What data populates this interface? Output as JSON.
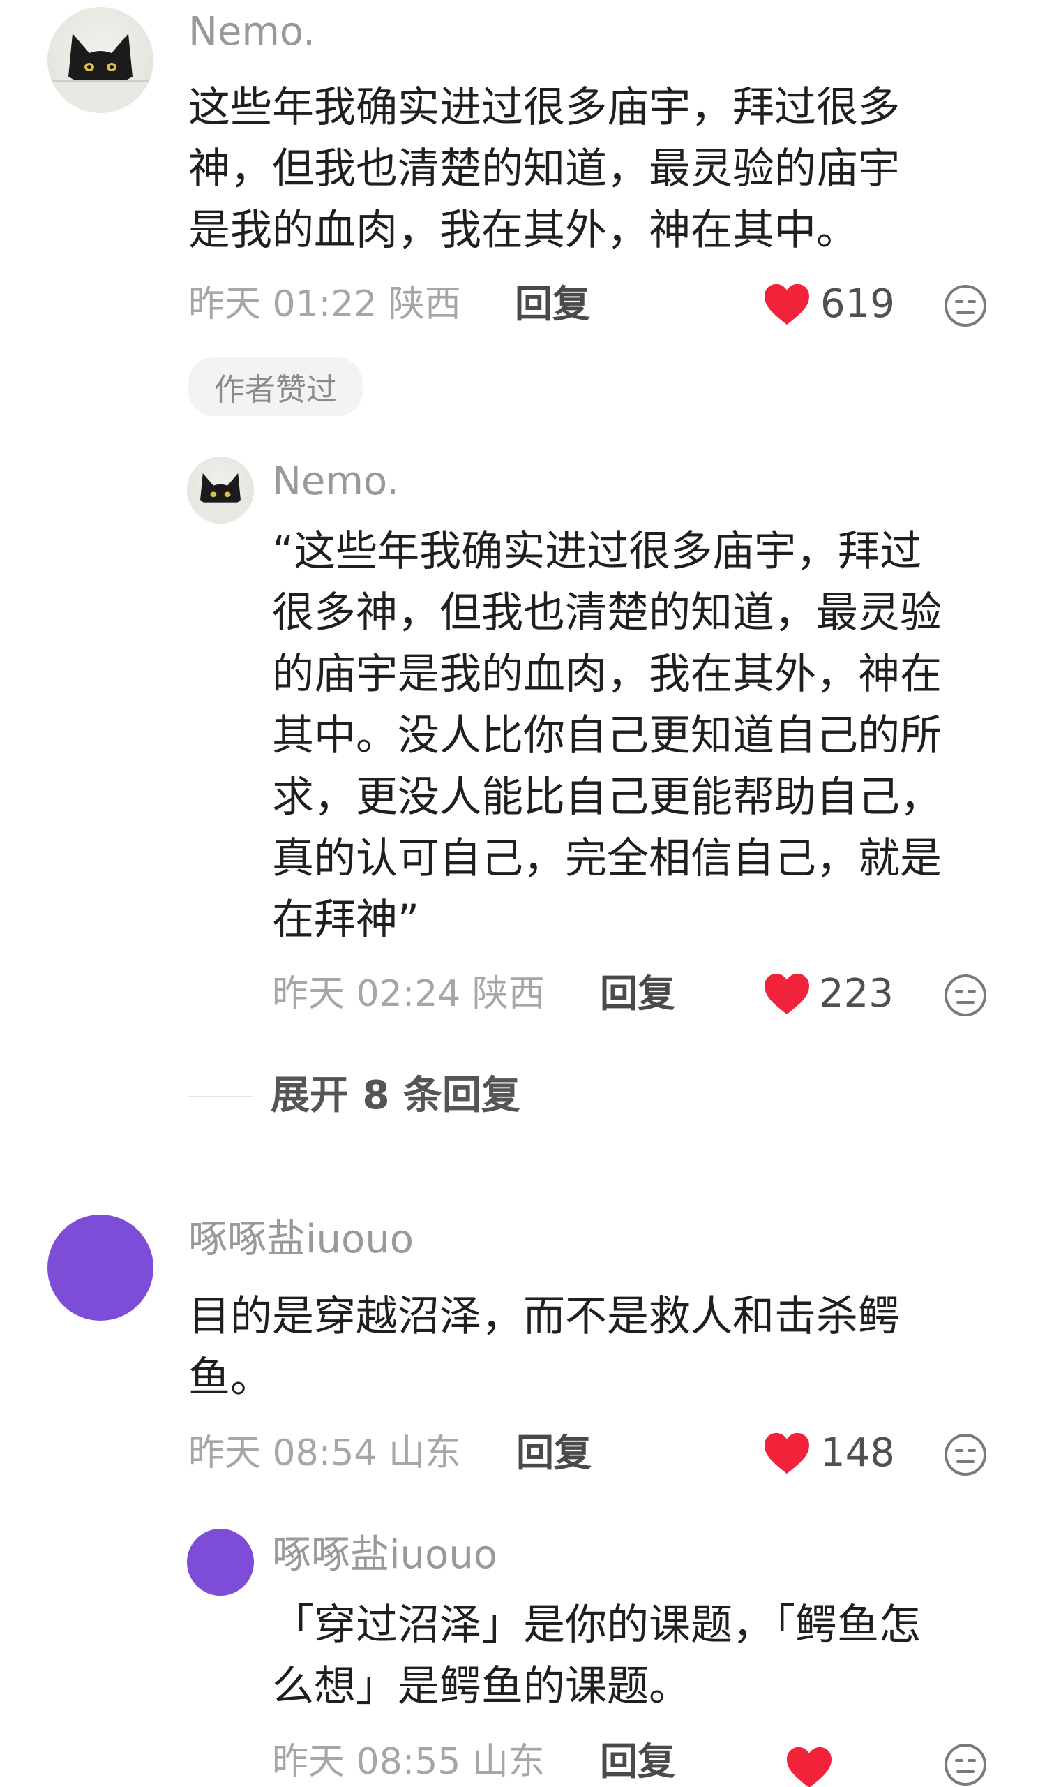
{
  "comments": [
    {
      "username": "Nemo.",
      "text": "这些年我确实进过很多庙宇，拜过很多\n神，但我也清楚的知道，最灵验的庙宇\n是我的血肉，我在其外，神在其中。",
      "time": "昨天 01:22",
      "location": "陕西",
      "reply_label": "回复",
      "likes": "619",
      "badge": "作者赞过"
    },
    {
      "username": "Nemo.",
      "text": "“这些年我确实进过很多庙宇，拜过\n很多神，但我也清楚的知道，最灵验\n的庙宇是我的血肉，我在其外，神在\n其中。没人比你自己更知道自己的所\n求，更没人能比自己更能帮助自己，\n真的认可自己，完全相信自己，就是\n在拜神”",
      "time": "昨天 02:24",
      "location": "陕西",
      "reply_label": "回复",
      "likes": "223"
    },
    {
      "username": "啄啄盐iuouo",
      "text": "目的是穿越沼泽，而不是救人和击杀鳄\n鱼。",
      "time": "昨天 08:54",
      "location": "山东",
      "reply_label": "回复",
      "likes": "148"
    },
    {
      "username": "啄啄盐iuouo",
      "text": "「穿过沼泽」是你的课题，「鳄鱼怎\n么想」是鳄鱼的课题。",
      "time": "昨天 08:55",
      "location": "山东",
      "reply_label": "回复"
    }
  ],
  "expand_replies": "展开 8 条回复",
  "icons": {
    "like": "heart-icon",
    "dislike": "dislike-face-icon"
  },
  "colors": {
    "heart": "#f0233b",
    "purple_avatar": "#7e4dd8",
    "text": "#1f1f1f",
    "muted": "#a6a6a6"
  }
}
